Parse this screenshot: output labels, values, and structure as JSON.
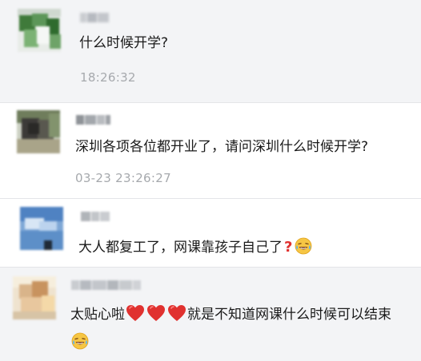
{
  "colors": {
    "row_bg": "#f3f4f6",
    "row_bg_alt": "#ffffff",
    "text": "#1a1a1a",
    "meta": "#a6a9ad",
    "heart": "#e0312f",
    "emoji_face": "#f6c644"
  },
  "comments": [
    {
      "text": "什么时候开学?",
      "time": "18:26:32"
    },
    {
      "text": "深圳各项各位都开业了，请问深圳什么时候开学?",
      "time": "03-23 23:26:27"
    },
    {
      "text": "大人都复工了，网课靠孩子自己了",
      "icons": [
        "red-question-mark-icon",
        "laughing-crying-emoji-icon"
      ]
    },
    {
      "text_before": "太贴心啦",
      "icons_hearts": [
        "red-heart-icon",
        "red-heart-icon",
        "red-heart-icon"
      ],
      "text_after": "就是不知道网课什么时候可以结束",
      "icons_end": [
        "laughing-crying-emoji-icon"
      ]
    }
  ]
}
